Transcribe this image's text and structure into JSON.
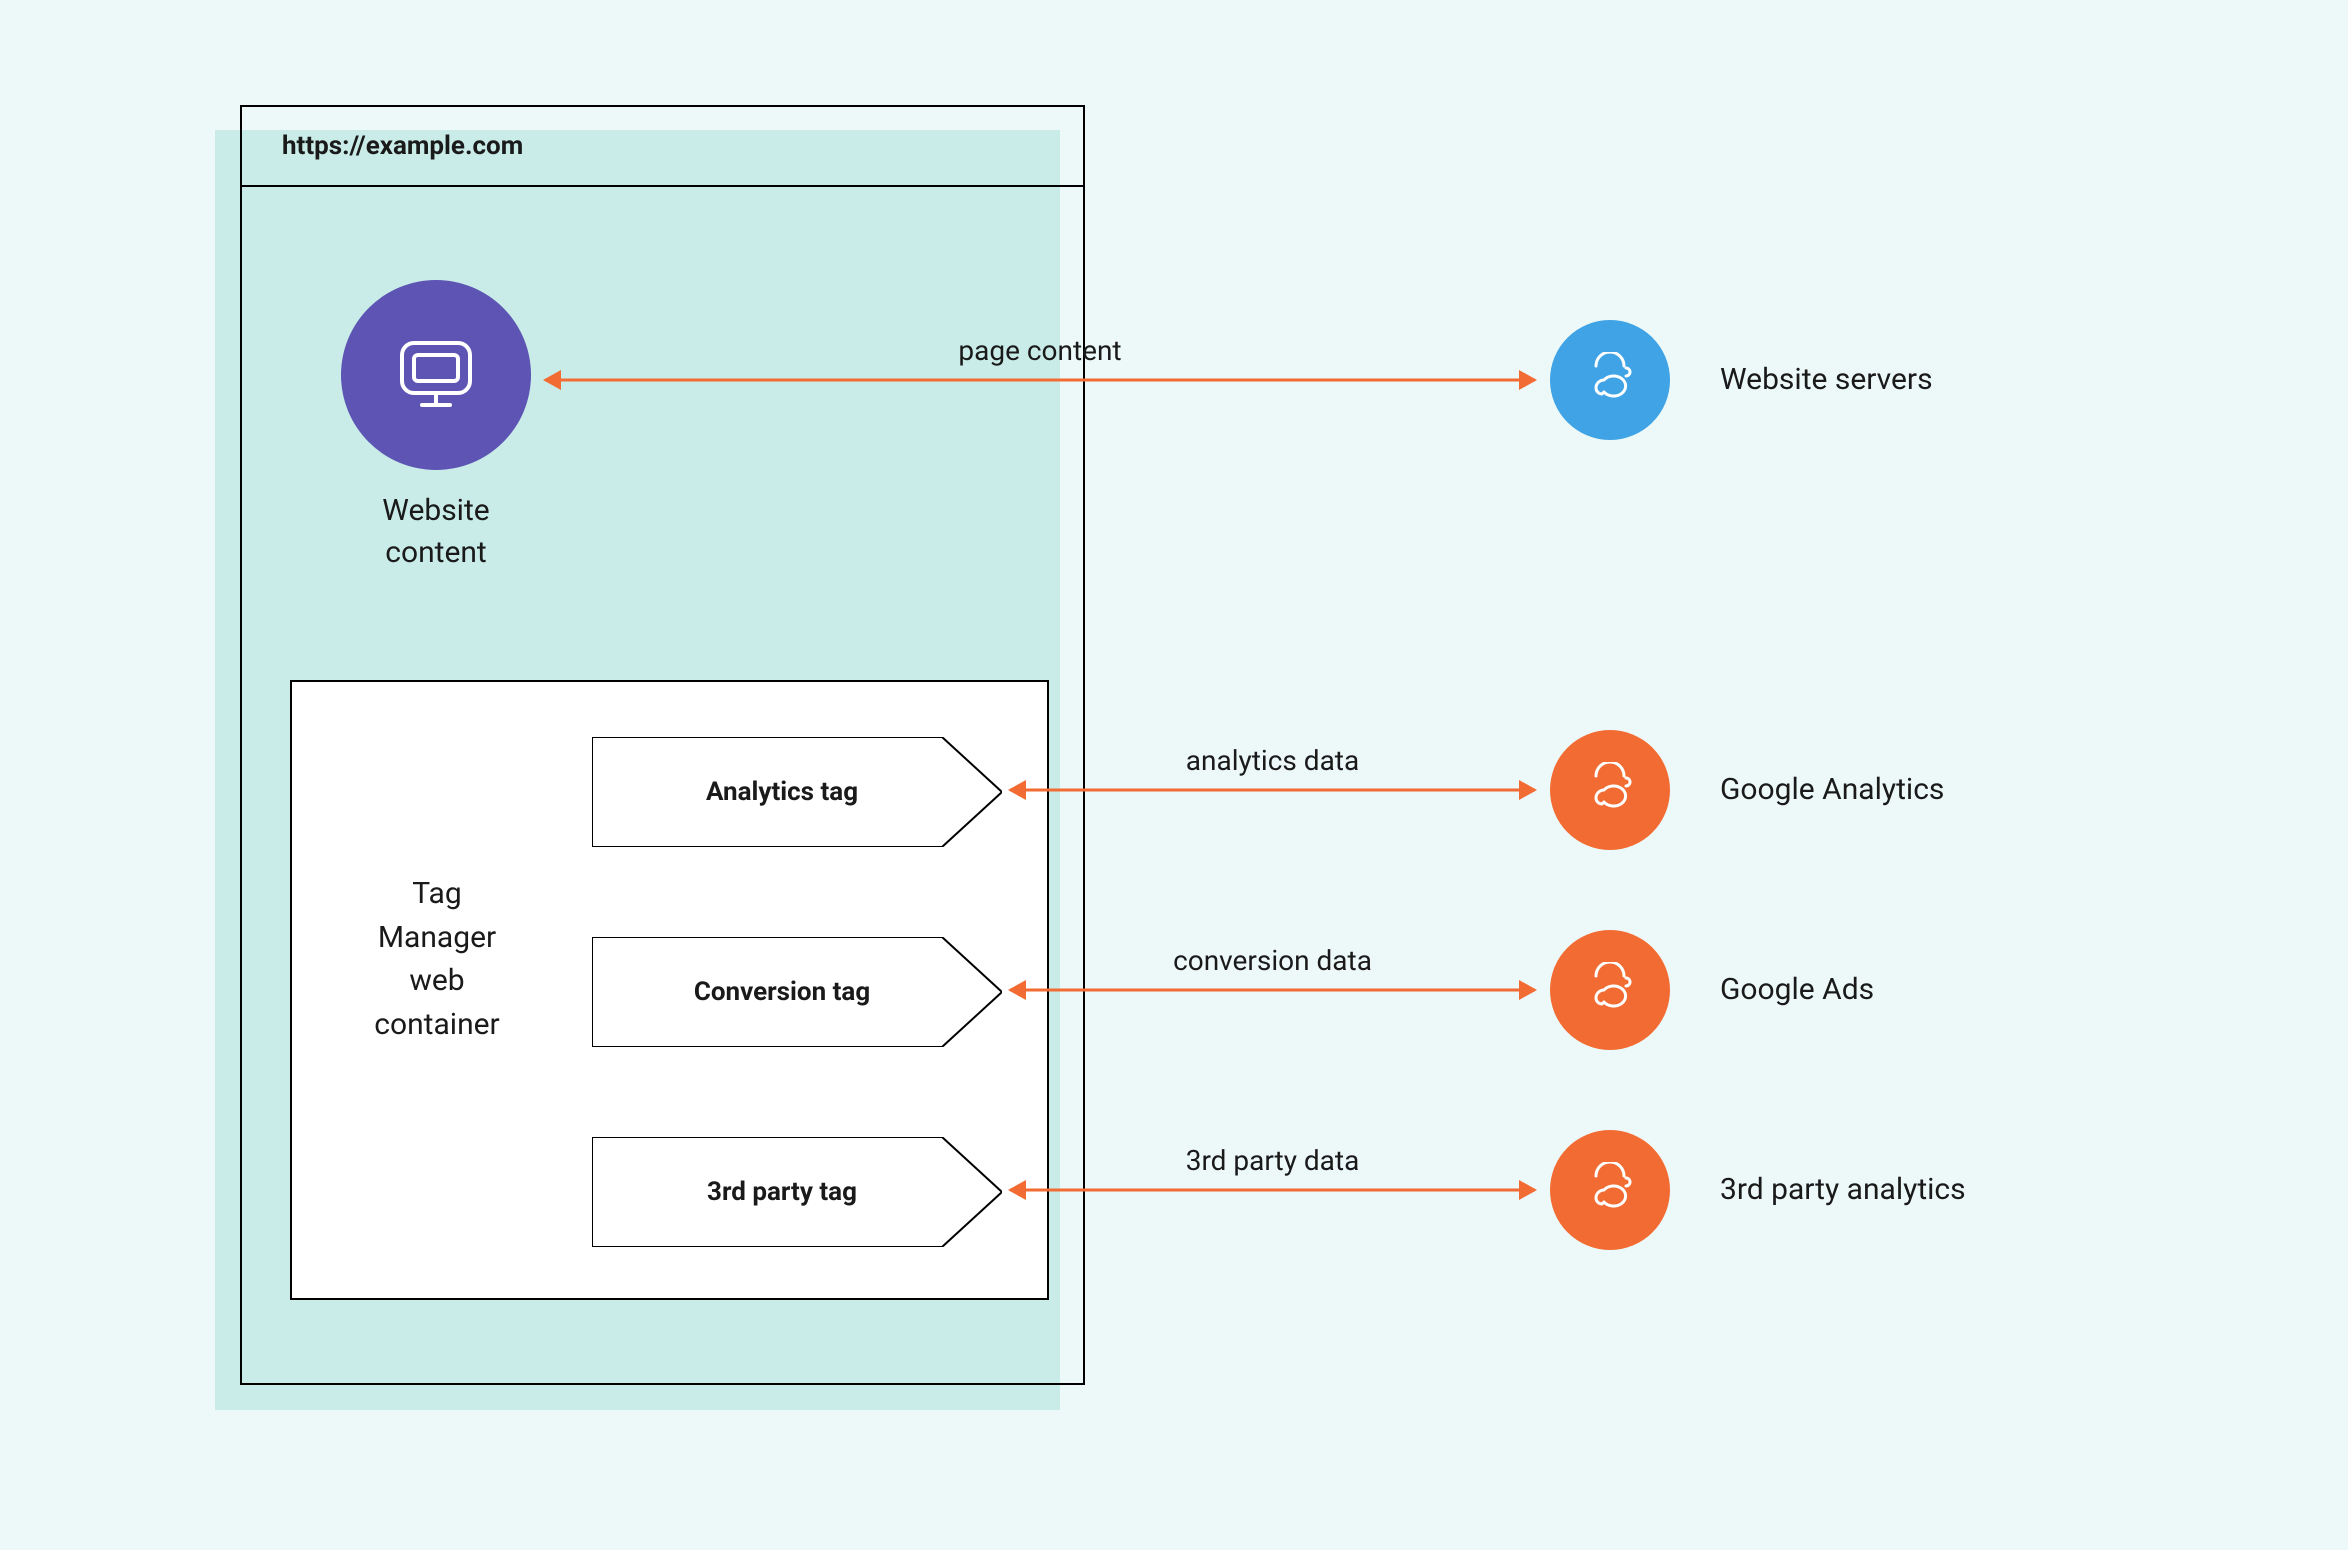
{
  "browser": {
    "url": "https://example.com"
  },
  "nodes": {
    "website_content": "Website\ncontent",
    "tag_manager": "Tag\nManager\nweb\ncontainer",
    "tags": {
      "analytics": "Analytics tag",
      "conversion": "Conversion tag",
      "third_party": "3rd party tag"
    }
  },
  "remote": {
    "website_servers": "Website servers",
    "google_analytics": "Google Analytics",
    "google_ads": "Google Ads",
    "third_party_analytics": "3rd party analytics"
  },
  "arrows": {
    "page_content": "page content",
    "analytics_data": "analytics data",
    "conversion_data": "conversion data",
    "third_party_data": "3rd party data"
  },
  "colors": {
    "purple": "#5d54b4",
    "blue": "#3fa3e6",
    "orange": "#f26b33",
    "arrow": "#f26b33",
    "canvas_bg": "#ecf9f8",
    "shadow": "#c9ece8"
  }
}
